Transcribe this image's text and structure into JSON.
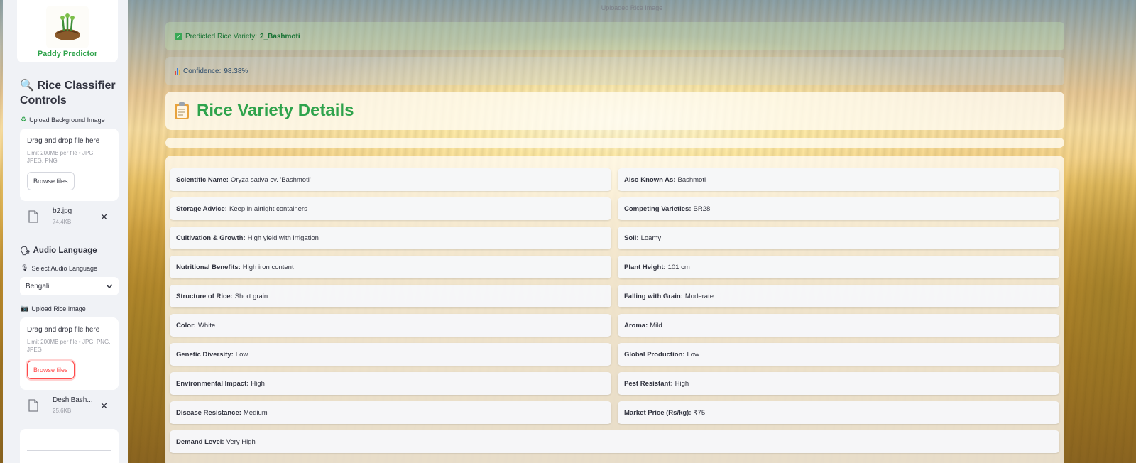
{
  "sidebar": {
    "logo_text": "Paddy Predictor",
    "title": "Rice Classifier Controls",
    "bg_upload": {
      "label": "Upload Background Image",
      "drop_text": "Drag and drop file here",
      "limit_text": "Limit 200MB per file • JPG, JPEG, PNG",
      "browse_label": "Browse files",
      "file": {
        "name": "b2.jpg",
        "size": "74.4KB"
      }
    },
    "audio": {
      "heading": "Audio Language",
      "select_label": "Select Audio Language",
      "selected": "Bengali"
    },
    "rice_upload": {
      "label": "Upload Rice Image",
      "drop_text": "Drag and drop file here",
      "limit_text": "Limit 200MB per file • JPG, PNG, JPEG",
      "browse_label": "Browse files",
      "file": {
        "name": "DeshiBash...",
        "size": "25.6KB"
      }
    }
  },
  "main": {
    "image_caption": "Uploaded Rice Image",
    "prediction": {
      "label": "Predicted Rice Variety:",
      "value": "2_Bashmoti"
    },
    "confidence": {
      "label": "Confidence:",
      "value": "98.38%"
    },
    "details_title": "Rice Variety Details",
    "details": [
      {
        "key": "Scientific Name:",
        "value": "Oryza sativa cv. 'Bashmoti'"
      },
      {
        "key": "Also Known As:",
        "value": "Bashmoti"
      },
      {
        "key": "Storage Advice:",
        "value": "Keep in airtight containers"
      },
      {
        "key": "Competing Varieties:",
        "value": "BR28"
      },
      {
        "key": "Cultivation & Growth:",
        "value": "High yield with irrigation"
      },
      {
        "key": "Soil:",
        "value": "Loamy"
      },
      {
        "key": "Nutritional Benefits:",
        "value": "High iron content"
      },
      {
        "key": "Plant Height:",
        "value": "101 cm"
      },
      {
        "key": "Structure of Rice:",
        "value": "Short grain"
      },
      {
        "key": "Falling with Grain:",
        "value": "Moderate"
      },
      {
        "key": "Color:",
        "value": "White"
      },
      {
        "key": "Aroma:",
        "value": "Mild"
      },
      {
        "key": "Genetic Diversity:",
        "value": "Low"
      },
      {
        "key": "Global Production:",
        "value": "Low"
      },
      {
        "key": "Environmental Impact:",
        "value": "High"
      },
      {
        "key": "Pest Resistant:",
        "value": "High"
      },
      {
        "key": "Disease Resistance:",
        "value": "Medium"
      },
      {
        "key": "Market Price (Rs/kg):",
        "value": "₹75"
      },
      {
        "key": "Demand Level:",
        "value": "Very High"
      }
    ]
  },
  "colors": {
    "accent_green": "#2fa34c",
    "primary_red": "#ff4b4b",
    "sidebar_bg": "#f0f2f6"
  },
  "icons": [
    "paddy-logo-icon",
    "magnifier-icon",
    "recycle-icon",
    "speaker-icon",
    "microphone-icon",
    "camera-icon",
    "file-icon",
    "close-icon",
    "chevron-down-icon",
    "checkmark-icon",
    "bar-chart-icon",
    "clipboard-icon"
  ]
}
